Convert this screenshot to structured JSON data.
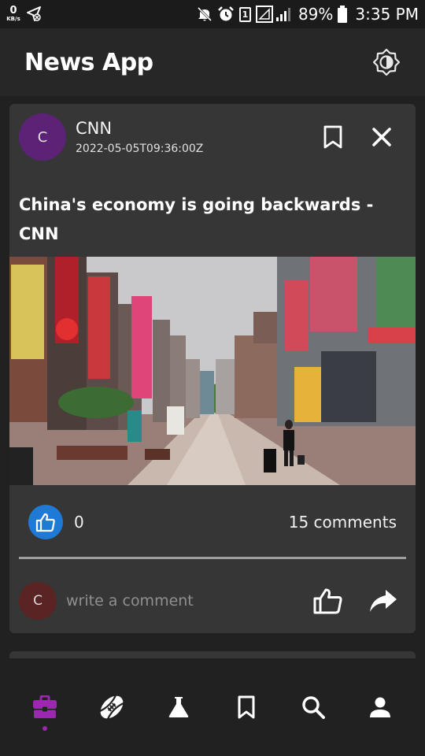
{
  "status_bar": {
    "net_speed": "0",
    "net_unit": "KB/s",
    "sim_number": "1",
    "battery_percent": "89%",
    "time": "3:35 PM"
  },
  "app_bar": {
    "title": "News App",
    "theme_icon": "brightness-icon"
  },
  "article": {
    "source_initial": "C",
    "source_name": "CNN",
    "published_at": "2022-05-05T09:36:00Z",
    "headline": "China's economy is going backwards - CNN",
    "image_alt": "Shanghai pedestrian shopping street with neon signs and a masked woman pulling luggage",
    "likes": "0",
    "comments_label": "15 comments"
  },
  "comment_box": {
    "user_initial": "C",
    "placeholder": "write a comment"
  },
  "bottom_nav": {
    "items": [
      "business-icon",
      "sports-icon",
      "science-icon",
      "bookmarks-icon",
      "search-icon",
      "profile-icon"
    ],
    "active_index": 0
  },
  "colors": {
    "accent": "#9c27b0",
    "like_blue": "#1f7ad6",
    "avatar_purple": "#5b2275",
    "avatar_maroon": "#5a2424",
    "card_bg": "#363636",
    "bg": "#212121"
  }
}
